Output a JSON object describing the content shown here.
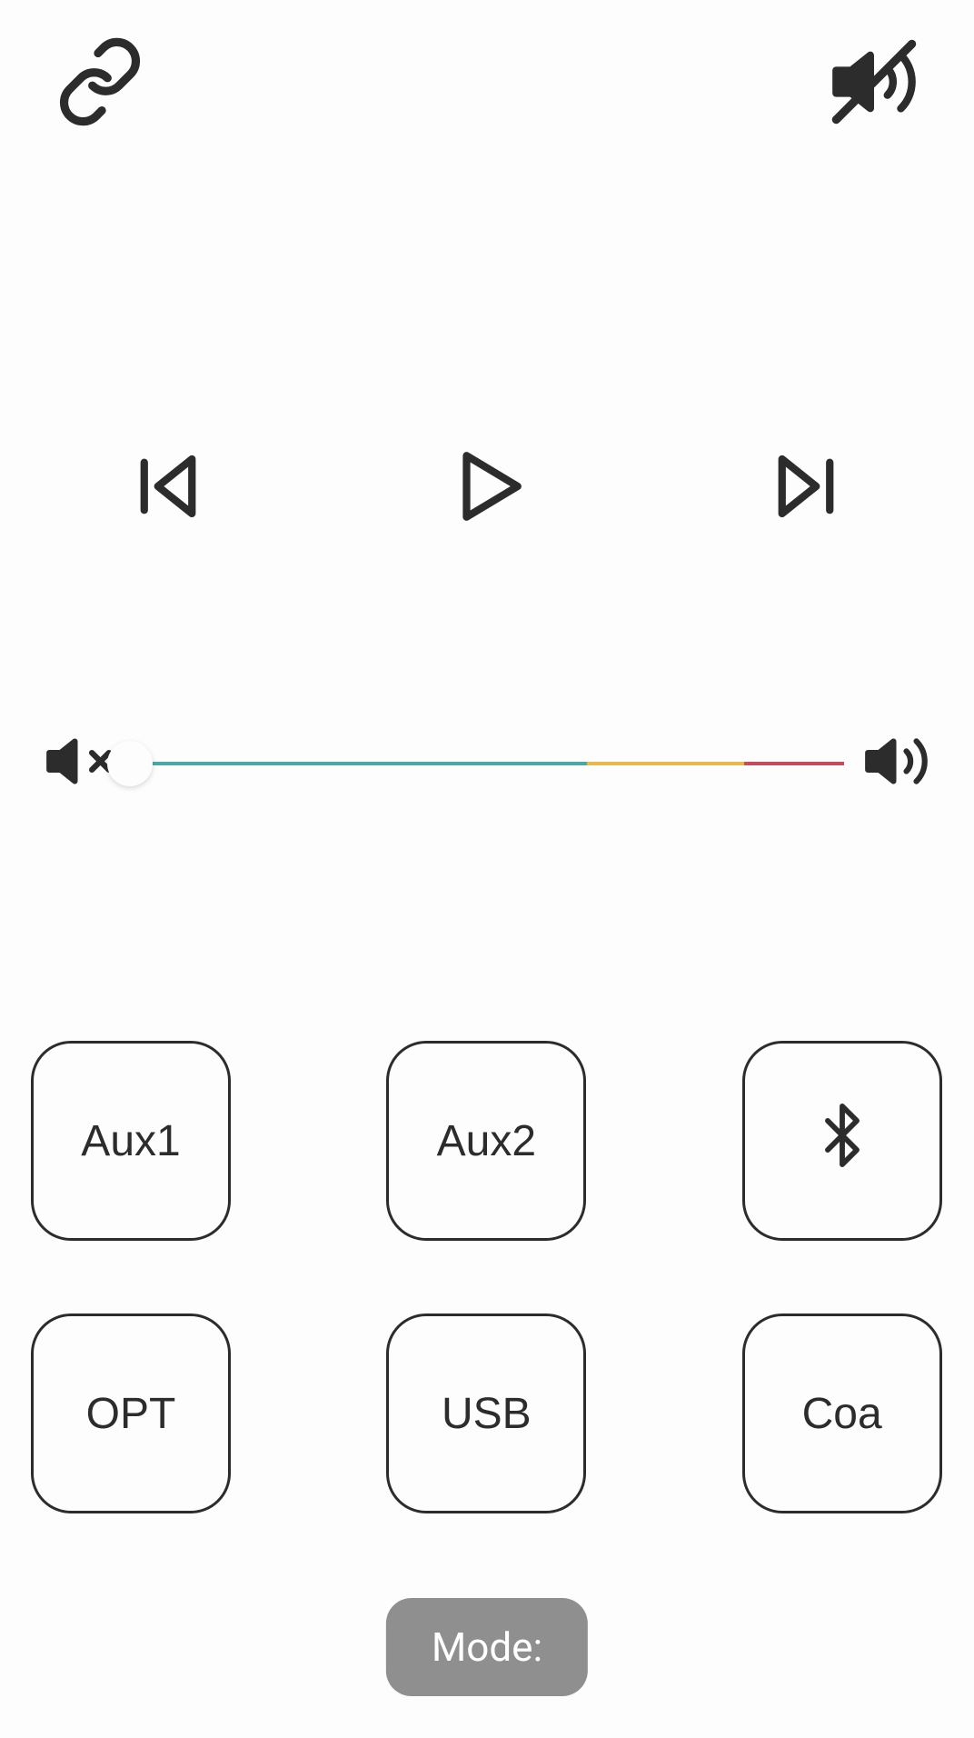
{
  "header": {
    "link_icon": "link-icon",
    "mute_icon": "volume-mute-slash-icon"
  },
  "playback": {
    "previous": "previous-track",
    "play": "play",
    "next": "next-track"
  },
  "volume": {
    "low_icon": "volume-mute-icon",
    "high_icon": "volume-high-icon",
    "value": 0,
    "segments": {
      "teal": "#48a9a6",
      "yellow": "#e8b84a",
      "red": "#c94c5c"
    }
  },
  "sources": {
    "items": [
      {
        "label": "Aux1",
        "type": "text"
      },
      {
        "label": "Aux2",
        "type": "text"
      },
      {
        "label": "Bluetooth",
        "type": "icon"
      },
      {
        "label": "OPT",
        "type": "text"
      },
      {
        "label": "USB",
        "type": "text"
      },
      {
        "label": "Coa",
        "type": "text"
      }
    ]
  },
  "mode": {
    "label": "Mode:"
  }
}
